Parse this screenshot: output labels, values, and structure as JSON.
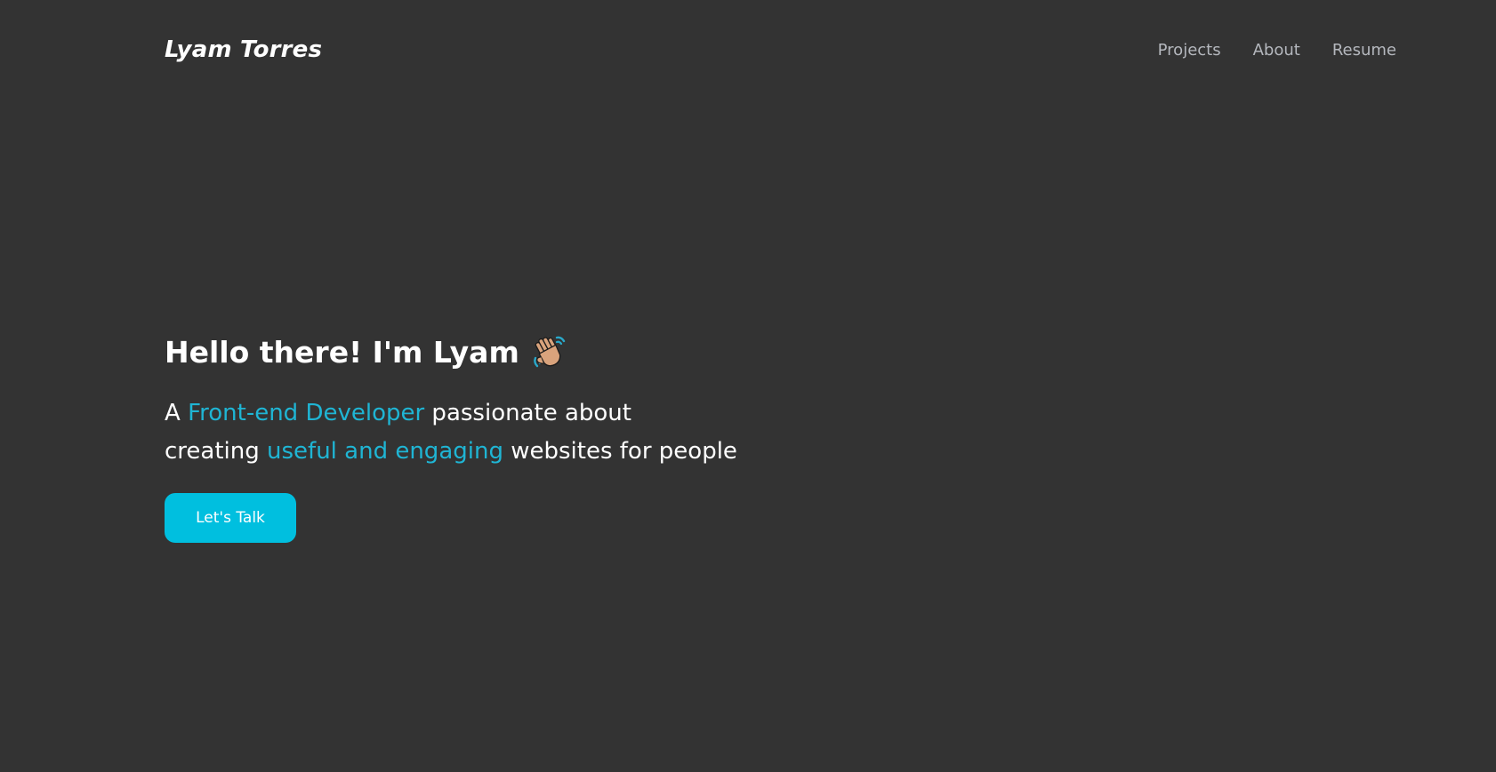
{
  "header": {
    "logo": "Lyam Torres",
    "nav": [
      "Projects",
      "About",
      "Resume"
    ]
  },
  "hero": {
    "greeting": "Hello there! I'm Lyam",
    "greeting_icon": "waving-hand-icon",
    "tagline": {
      "line1_pre": "A ",
      "line1_accent": "Front-end Developer",
      "line1_post": " passionate about",
      "line2_pre": "creating ",
      "line2_accent": "useful and engaging",
      "line2_post": " websites for people"
    },
    "cta_label": "Let's Talk"
  },
  "colors": {
    "background": "#333333",
    "accent_text": "#1fb5d4",
    "button": "#00bfdf",
    "nav_text": "#b4b7bd"
  }
}
